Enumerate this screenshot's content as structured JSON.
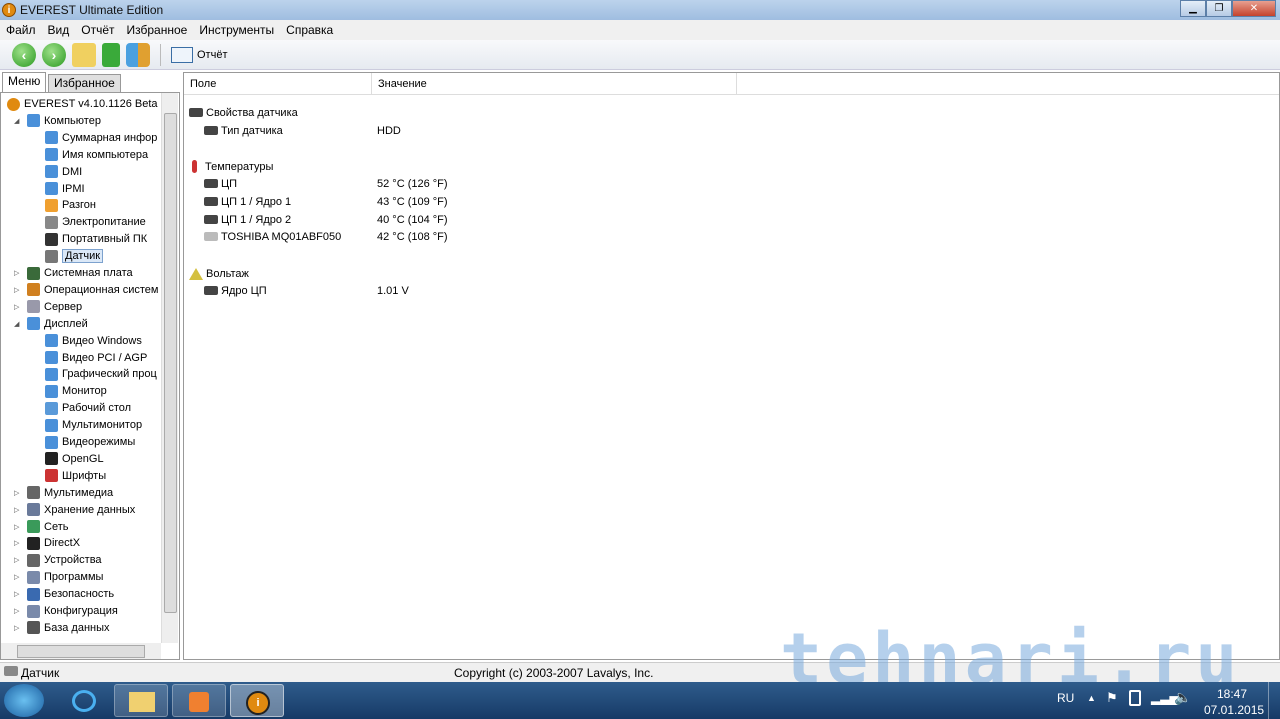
{
  "window": {
    "title": "EVEREST Ultimate Edition"
  },
  "menu": [
    "Файл",
    "Вид",
    "Отчёт",
    "Избранное",
    "Инструменты",
    "Справка"
  ],
  "toolbar": {
    "report_label": "Отчёт"
  },
  "tabs": {
    "menu": "Меню",
    "favorites": "Избранное"
  },
  "tree": [
    {
      "label": "EVEREST v4.10.1126 Beta",
      "level": 0,
      "color": "#e08a10"
    },
    {
      "label": "Компьютер",
      "level": 1,
      "exp": "◢",
      "color": "#4a90d9"
    },
    {
      "label": "Суммарная инфор",
      "level": 2,
      "color": "#4a90d9"
    },
    {
      "label": "Имя компьютера",
      "level": 2,
      "color": "#4a90d9"
    },
    {
      "label": "DMI",
      "level": 2,
      "color": "#4a90d9"
    },
    {
      "label": "IPMI",
      "level": 2,
      "color": "#4a90d9"
    },
    {
      "label": "Разгон",
      "level": 2,
      "color": "#f0a030"
    },
    {
      "label": "Электропитание",
      "level": 2,
      "color": "#888"
    },
    {
      "label": "Портативный ПК",
      "level": 2,
      "color": "#333"
    },
    {
      "label": "Датчик",
      "level": 2,
      "color": "#777",
      "selected": true
    },
    {
      "label": "Системная плата",
      "level": 1,
      "exp": "▷",
      "color": "#3a6a3a"
    },
    {
      "label": "Операционная систем",
      "level": 1,
      "exp": "▷",
      "color": "#d08020"
    },
    {
      "label": "Сервер",
      "level": 1,
      "exp": "▷",
      "color": "#99a"
    },
    {
      "label": "Дисплей",
      "level": 1,
      "exp": "◢",
      "color": "#4a90d9"
    },
    {
      "label": "Видео Windows",
      "level": 2,
      "color": "#4a90d9"
    },
    {
      "label": "Видео PCI / AGP",
      "level": 2,
      "color": "#4a90d9"
    },
    {
      "label": "Графический проц",
      "level": 2,
      "color": "#4a90d9"
    },
    {
      "label": "Монитор",
      "level": 2,
      "color": "#4a90d9"
    },
    {
      "label": "Рабочий стол",
      "level": 2,
      "color": "#5a9ad9"
    },
    {
      "label": "Мультимонитор",
      "level": 2,
      "color": "#4a90d9"
    },
    {
      "label": "Видеорежимы",
      "level": 2,
      "color": "#4a90d9"
    },
    {
      "label": "OpenGL",
      "level": 2,
      "color": "#222"
    },
    {
      "label": "Шрифты",
      "level": 2,
      "color": "#c33"
    },
    {
      "label": "Мультимедиа",
      "level": 1,
      "exp": "▷",
      "color": "#666"
    },
    {
      "label": "Хранение данных",
      "level": 1,
      "exp": "▷",
      "color": "#6a7a9a"
    },
    {
      "label": "Сеть",
      "level": 1,
      "exp": "▷",
      "color": "#3a9a5a"
    },
    {
      "label": "DirectX",
      "level": 1,
      "exp": "▷",
      "color": "#222"
    },
    {
      "label": "Устройства",
      "level": 1,
      "exp": "▷",
      "color": "#666"
    },
    {
      "label": "Программы",
      "level": 1,
      "exp": "▷",
      "color": "#7a8aaa"
    },
    {
      "label": "Безопасность",
      "level": 1,
      "exp": "▷",
      "color": "#3a6ab0"
    },
    {
      "label": "Конфигурация",
      "level": 1,
      "exp": "▷",
      "color": "#7a8aaa"
    },
    {
      "label": "База данных",
      "level": 1,
      "exp": "▷",
      "color": "#555"
    }
  ],
  "columns": {
    "field": "Поле",
    "value": "Значение"
  },
  "rows": [
    {
      "type": "group",
      "field": "Свойства датчика",
      "icon": "chip"
    },
    {
      "type": "item",
      "field": "Тип датчика",
      "value": "HDD",
      "icon": "chip"
    },
    {
      "type": "group",
      "field": "Температуры",
      "icon": "thermometer"
    },
    {
      "type": "item",
      "field": "ЦП",
      "value": "52 °C  (126 °F)",
      "icon": "cpu"
    },
    {
      "type": "item",
      "field": "ЦП 1 / Ядро 1",
      "value": "43 °C  (109 °F)",
      "icon": "cpu"
    },
    {
      "type": "item",
      "field": "ЦП 1 / Ядро 2",
      "value": "40 °C  (104 °F)",
      "icon": "cpu"
    },
    {
      "type": "item",
      "field": "TOSHIBA MQ01ABF050",
      "value": "42 °C  (108 °F)",
      "icon": "hdd"
    },
    {
      "type": "group",
      "field": "Вольтаж",
      "icon": "warning"
    },
    {
      "type": "item",
      "field": "Ядро ЦП",
      "value": "1.01 V",
      "icon": "cpu"
    }
  ],
  "status": {
    "left": "Датчик",
    "center": "Copyright (c) 2003-2007 Lavalys, Inc."
  },
  "tray": {
    "lang": "RU",
    "time": "18:47",
    "date": "07.01.2015"
  },
  "watermark": "tehnari.ru"
}
